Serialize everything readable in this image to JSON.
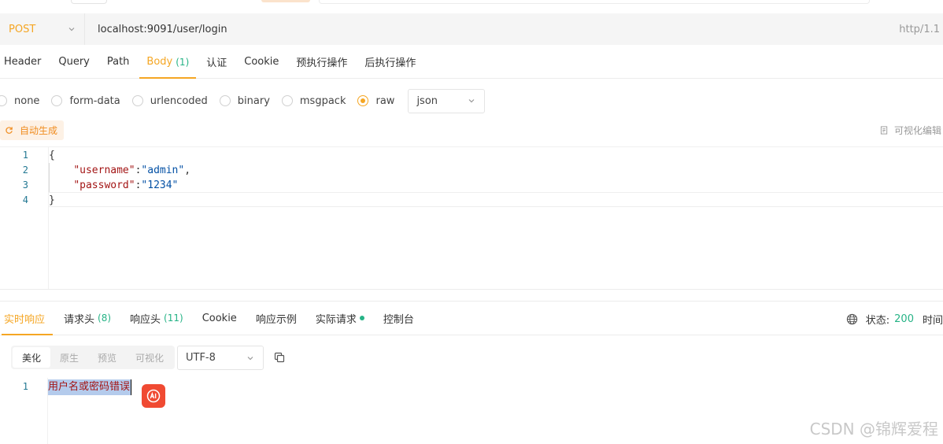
{
  "request": {
    "method": "POST",
    "url": "localhost:9091/user/login",
    "protocol": "http/1.1"
  },
  "request_tabs": [
    {
      "label": "Header"
    },
    {
      "label": "Query"
    },
    {
      "label": "Path"
    },
    {
      "label": "Body",
      "count": "(1)",
      "active": true
    },
    {
      "label": "认证"
    },
    {
      "label": "Cookie"
    },
    {
      "label": "预执行操作"
    },
    {
      "label": "后执行操作"
    }
  ],
  "body_types": {
    "options": [
      "none",
      "form-data",
      "urlencoded",
      "binary",
      "msgpack",
      "raw"
    ],
    "selected": "raw",
    "raw_format": "json"
  },
  "body_tools": {
    "auto_generate_label": "自动生成",
    "visual_edit_label": "可视化编辑"
  },
  "editor": {
    "lines": [
      {
        "num": "1",
        "open": "{"
      },
      {
        "num": "2",
        "key": "\"username\"",
        "sep": ":",
        "value": "\"admin\"",
        "tail": ","
      },
      {
        "num": "3",
        "key": "\"password\"",
        "sep": ":",
        "value": "\"1234\"",
        "tail": ""
      },
      {
        "num": "4",
        "close": "}"
      }
    ]
  },
  "response_tabs": [
    {
      "label": "实时响应",
      "active": true
    },
    {
      "label": "请求头",
      "count": "(8)"
    },
    {
      "label": "响应头",
      "count": "(11)"
    },
    {
      "label": "Cookie"
    },
    {
      "label": "响应示例"
    },
    {
      "label": "实际请求",
      "dot": true
    },
    {
      "label": "控制台"
    }
  ],
  "response_status": {
    "label": "状态:",
    "code": "200",
    "time_label": "时间"
  },
  "response_view": {
    "modes": [
      "美化",
      "原生",
      "预览",
      "可视化"
    ],
    "active_mode": "美化",
    "encoding": "UTF-8"
  },
  "response_body": {
    "line_num": "1",
    "text": "用户名或密码错误"
  },
  "watermark": "CSDN @锦辉爱程",
  "colors": {
    "accent": "#f5a623",
    "success": "#26b386",
    "ai_badge": "#f04a32"
  }
}
